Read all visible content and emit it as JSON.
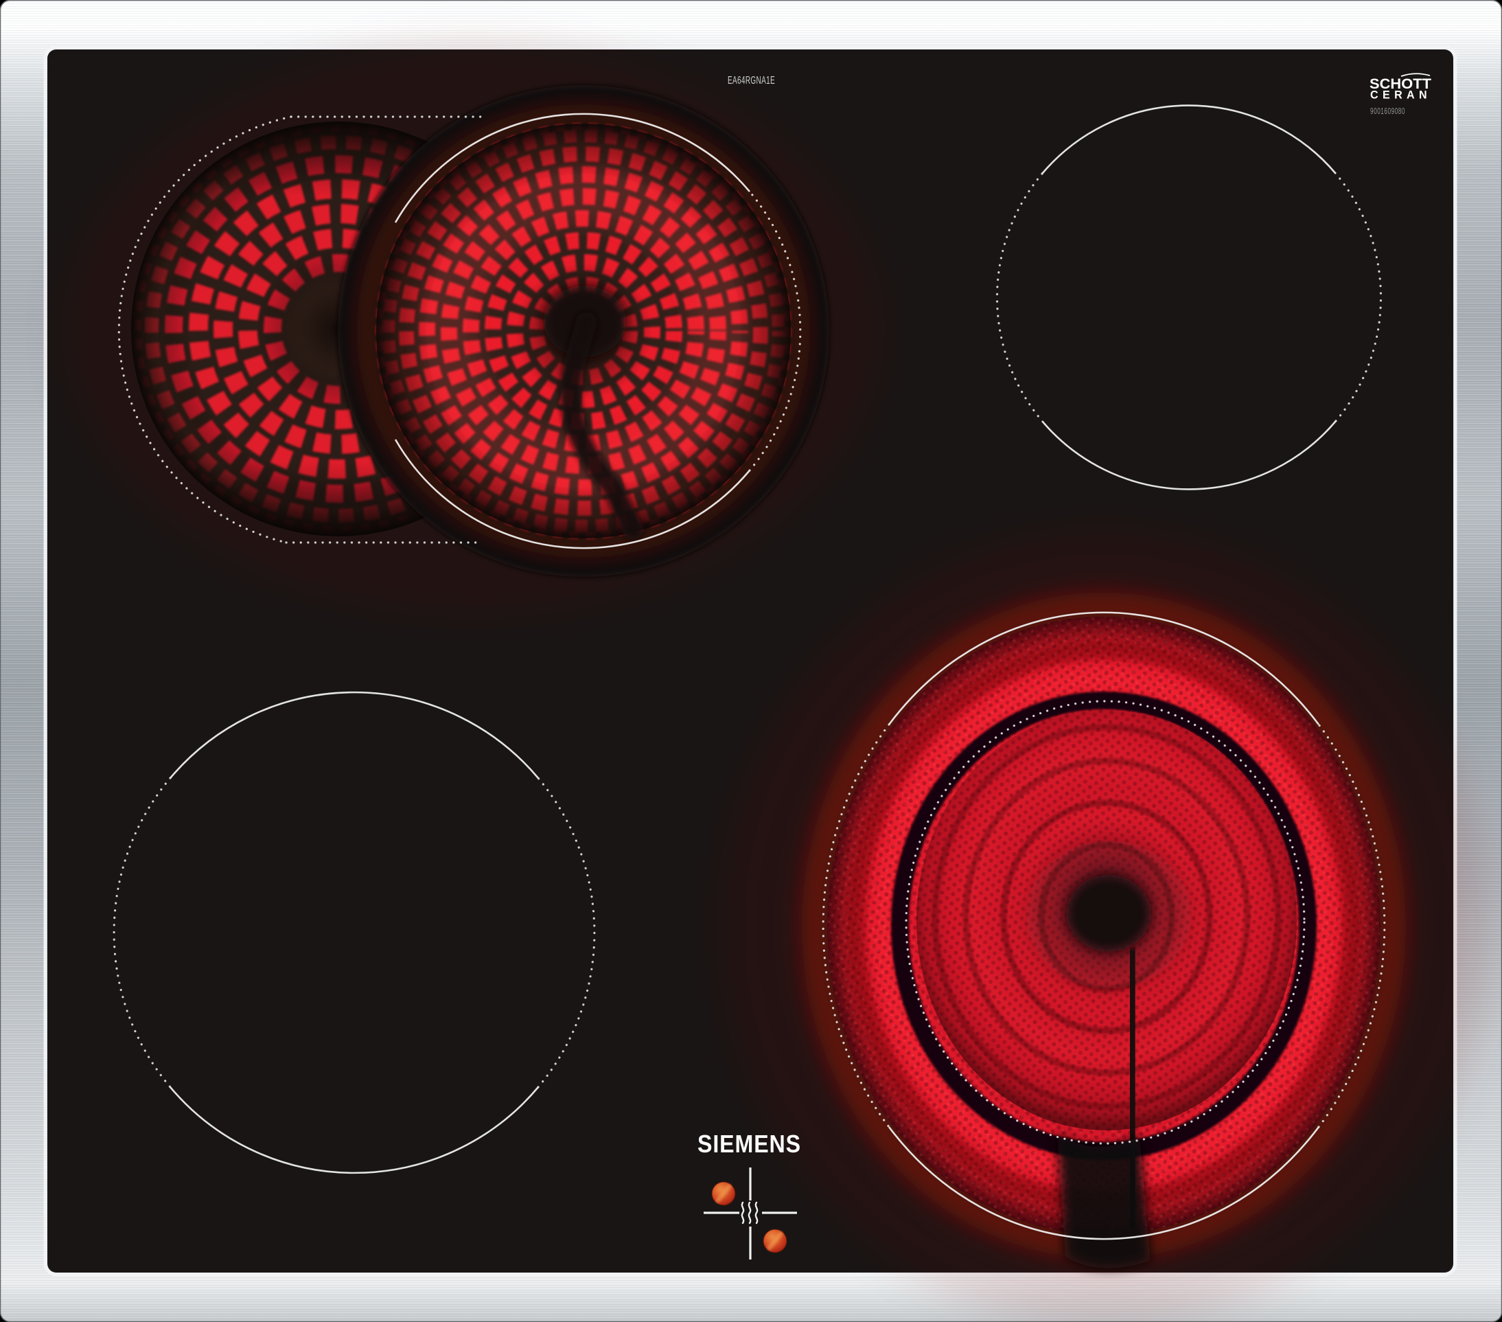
{
  "branding": {
    "manufacturer_logo": "SIEMENS",
    "model_number": "EA64RGNA1E"
  },
  "glass_branding": {
    "glass_maker_line1": "SCHOTT",
    "glass_maker_line2": "CERAN",
    "print_code": "9001609080"
  },
  "zones": {
    "back_left": {
      "name": "dual extension radiant zone",
      "state": "glowing"
    },
    "back_right": {
      "name": "standard radiant zone",
      "state": "off"
    },
    "front_left": {
      "name": "standard radiant zone",
      "state": "off"
    },
    "front_right": {
      "name": "dual circuit radiant zone",
      "state": "glowing"
    }
  },
  "indicator": {
    "icon": "heat-waves-icon",
    "residual_heat_dots": 2
  },
  "colors": {
    "glow_red": "#ea1b2c",
    "glass_black": "#181514",
    "steel": "#c9ced3",
    "marking_white": "#ededed",
    "residual_dot_orange": "#d0542a"
  }
}
